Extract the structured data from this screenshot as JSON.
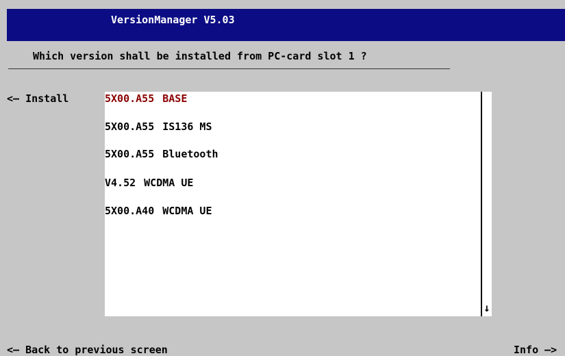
{
  "window": {
    "title": "VersionManager V5.03"
  },
  "prompt": {
    "question": "Which version shall be installed from PC-card slot 1 ?"
  },
  "left_action": {
    "label": "<— Install"
  },
  "version_list": {
    "items": [
      {
        "version": "5X00.A55",
        "description": "BASE",
        "selected": true
      },
      {
        "version": "5X00.A55",
        "description": "IS136 MS",
        "selected": false
      },
      {
        "version": "5X00.A55",
        "description": "Bluetooth",
        "selected": false
      },
      {
        "version": "V4.52",
        "description": "WCDMA UE",
        "selected": false
      },
      {
        "version": "5X00.A40",
        "description": "WCDMA UE",
        "selected": false
      }
    ],
    "scroll_arrow": "↓"
  },
  "footer": {
    "back_label": "<— Back to previous screen",
    "info_label": "Info —>"
  },
  "colors": {
    "title_bar": "#0c0c84",
    "background": "#c6c6c6",
    "list_background": "#ffffff",
    "selected_text": "#8b0000"
  }
}
